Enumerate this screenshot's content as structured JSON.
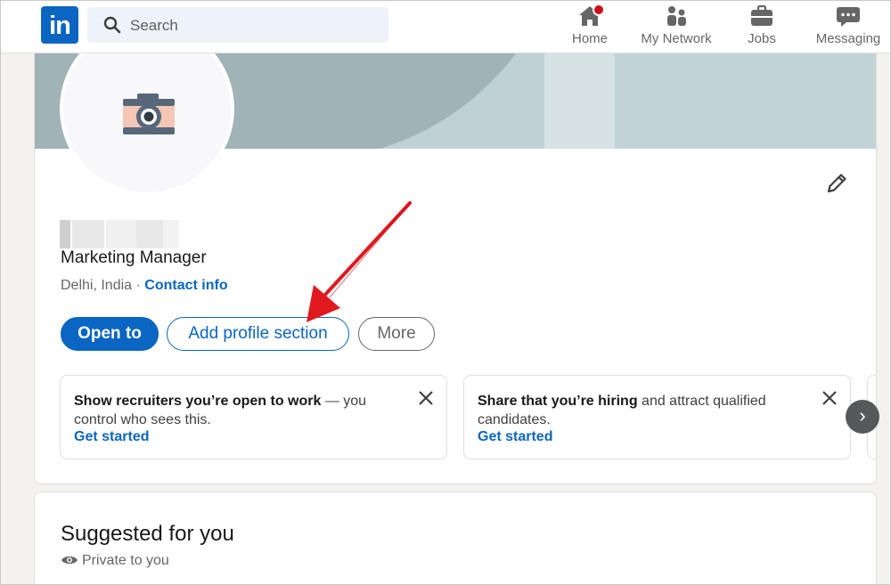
{
  "nav": {
    "logo_text": "in",
    "search_placeholder": "Search",
    "items": [
      {
        "label": "Home",
        "icon": "home-icon",
        "badge": true
      },
      {
        "label": "My Network",
        "icon": "network-icon"
      },
      {
        "label": "Jobs",
        "icon": "briefcase-icon"
      },
      {
        "label": "Messaging",
        "icon": "messaging-icon"
      }
    ]
  },
  "profile": {
    "headline": "Marketing Manager",
    "location": "Delhi, India",
    "separator": " · ",
    "contact_label": "Contact info",
    "buttons": {
      "open_to": "Open to",
      "add_section": "Add profile section",
      "more": "More"
    }
  },
  "promos": [
    {
      "bold": "Show recruiters you’re open to work",
      "rest": " — you control who sees this.",
      "link": "Get started"
    },
    {
      "bold": "Share that you’re hiring",
      "rest": " and attract qualified candidates.",
      "link": "Get started"
    }
  ],
  "carousel_next": "›",
  "suggested": {
    "title": "Suggested for you",
    "private": "Private to you"
  },
  "colors": {
    "brand": "#0a66c2",
    "badge": "#cc1016",
    "annotation_arrow": "#e0191f"
  }
}
